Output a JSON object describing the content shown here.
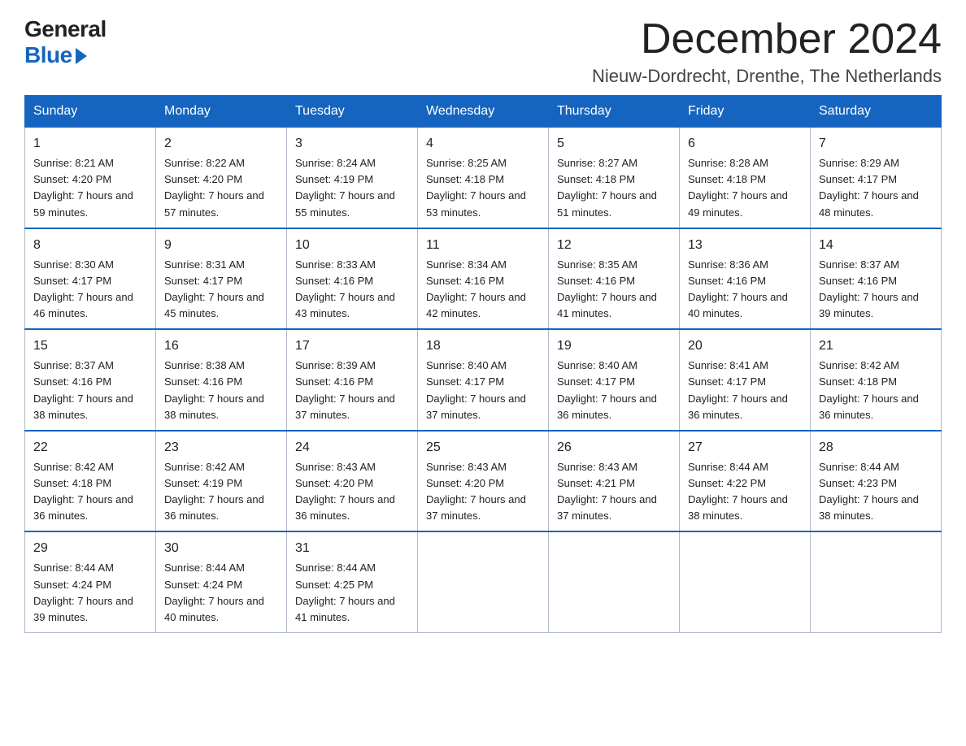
{
  "header": {
    "logo_general": "General",
    "logo_blue": "Blue",
    "month_title": "December 2024",
    "location": "Nieuw-Dordrecht, Drenthe, The Netherlands"
  },
  "weekdays": [
    "Sunday",
    "Monday",
    "Tuesday",
    "Wednesday",
    "Thursday",
    "Friday",
    "Saturday"
  ],
  "weeks": [
    [
      {
        "day": "1",
        "sunrise": "8:21 AM",
        "sunset": "4:20 PM",
        "daylight": "7 hours and 59 minutes."
      },
      {
        "day": "2",
        "sunrise": "8:22 AM",
        "sunset": "4:20 PM",
        "daylight": "7 hours and 57 minutes."
      },
      {
        "day": "3",
        "sunrise": "8:24 AM",
        "sunset": "4:19 PM",
        "daylight": "7 hours and 55 minutes."
      },
      {
        "day": "4",
        "sunrise": "8:25 AM",
        "sunset": "4:18 PM",
        "daylight": "7 hours and 53 minutes."
      },
      {
        "day": "5",
        "sunrise": "8:27 AM",
        "sunset": "4:18 PM",
        "daylight": "7 hours and 51 minutes."
      },
      {
        "day": "6",
        "sunrise": "8:28 AM",
        "sunset": "4:18 PM",
        "daylight": "7 hours and 49 minutes."
      },
      {
        "day": "7",
        "sunrise": "8:29 AM",
        "sunset": "4:17 PM",
        "daylight": "7 hours and 48 minutes."
      }
    ],
    [
      {
        "day": "8",
        "sunrise": "8:30 AM",
        "sunset": "4:17 PM",
        "daylight": "7 hours and 46 minutes."
      },
      {
        "day": "9",
        "sunrise": "8:31 AM",
        "sunset": "4:17 PM",
        "daylight": "7 hours and 45 minutes."
      },
      {
        "day": "10",
        "sunrise": "8:33 AM",
        "sunset": "4:16 PM",
        "daylight": "7 hours and 43 minutes."
      },
      {
        "day": "11",
        "sunrise": "8:34 AM",
        "sunset": "4:16 PM",
        "daylight": "7 hours and 42 minutes."
      },
      {
        "day": "12",
        "sunrise": "8:35 AM",
        "sunset": "4:16 PM",
        "daylight": "7 hours and 41 minutes."
      },
      {
        "day": "13",
        "sunrise": "8:36 AM",
        "sunset": "4:16 PM",
        "daylight": "7 hours and 40 minutes."
      },
      {
        "day": "14",
        "sunrise": "8:37 AM",
        "sunset": "4:16 PM",
        "daylight": "7 hours and 39 minutes."
      }
    ],
    [
      {
        "day": "15",
        "sunrise": "8:37 AM",
        "sunset": "4:16 PM",
        "daylight": "7 hours and 38 minutes."
      },
      {
        "day": "16",
        "sunrise": "8:38 AM",
        "sunset": "4:16 PM",
        "daylight": "7 hours and 38 minutes."
      },
      {
        "day": "17",
        "sunrise": "8:39 AM",
        "sunset": "4:16 PM",
        "daylight": "7 hours and 37 minutes."
      },
      {
        "day": "18",
        "sunrise": "8:40 AM",
        "sunset": "4:17 PM",
        "daylight": "7 hours and 37 minutes."
      },
      {
        "day": "19",
        "sunrise": "8:40 AM",
        "sunset": "4:17 PM",
        "daylight": "7 hours and 36 minutes."
      },
      {
        "day": "20",
        "sunrise": "8:41 AM",
        "sunset": "4:17 PM",
        "daylight": "7 hours and 36 minutes."
      },
      {
        "day": "21",
        "sunrise": "8:42 AM",
        "sunset": "4:18 PM",
        "daylight": "7 hours and 36 minutes."
      }
    ],
    [
      {
        "day": "22",
        "sunrise": "8:42 AM",
        "sunset": "4:18 PM",
        "daylight": "7 hours and 36 minutes."
      },
      {
        "day": "23",
        "sunrise": "8:42 AM",
        "sunset": "4:19 PM",
        "daylight": "7 hours and 36 minutes."
      },
      {
        "day": "24",
        "sunrise": "8:43 AM",
        "sunset": "4:20 PM",
        "daylight": "7 hours and 36 minutes."
      },
      {
        "day": "25",
        "sunrise": "8:43 AM",
        "sunset": "4:20 PM",
        "daylight": "7 hours and 37 minutes."
      },
      {
        "day": "26",
        "sunrise": "8:43 AM",
        "sunset": "4:21 PM",
        "daylight": "7 hours and 37 minutes."
      },
      {
        "day": "27",
        "sunrise": "8:44 AM",
        "sunset": "4:22 PM",
        "daylight": "7 hours and 38 minutes."
      },
      {
        "day": "28",
        "sunrise": "8:44 AM",
        "sunset": "4:23 PM",
        "daylight": "7 hours and 38 minutes."
      }
    ],
    [
      {
        "day": "29",
        "sunrise": "8:44 AM",
        "sunset": "4:24 PM",
        "daylight": "7 hours and 39 minutes."
      },
      {
        "day": "30",
        "sunrise": "8:44 AM",
        "sunset": "4:24 PM",
        "daylight": "7 hours and 40 minutes."
      },
      {
        "day": "31",
        "sunrise": "8:44 AM",
        "sunset": "4:25 PM",
        "daylight": "7 hours and 41 minutes."
      },
      null,
      null,
      null,
      null
    ]
  ]
}
